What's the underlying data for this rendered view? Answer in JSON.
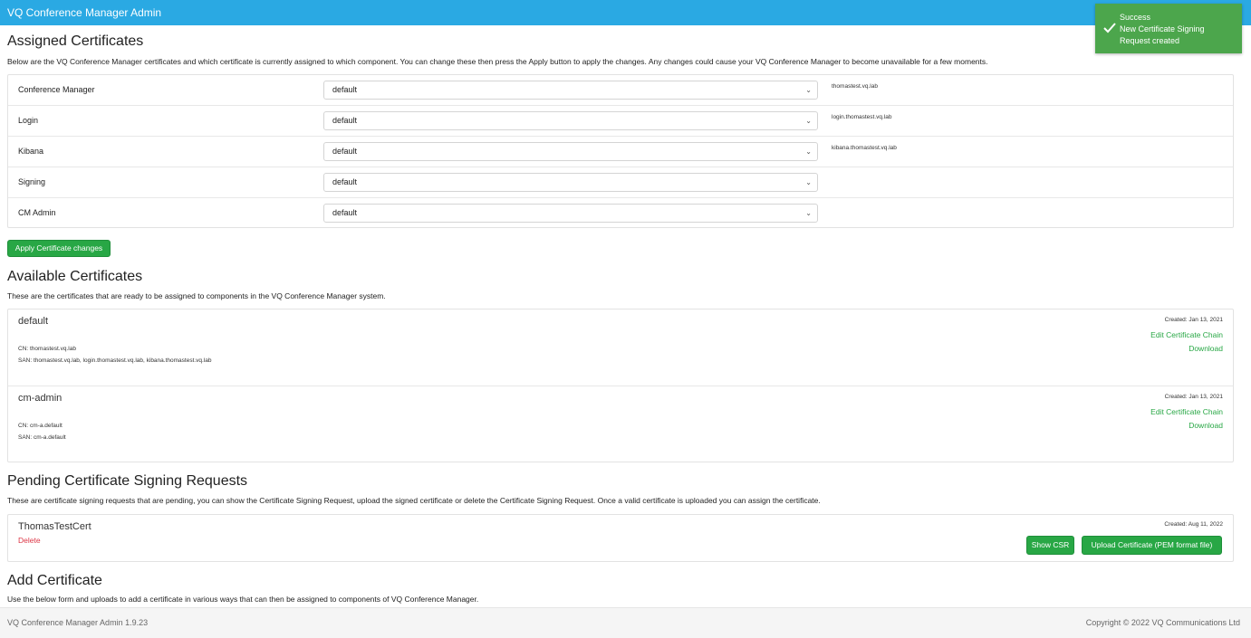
{
  "header": {
    "title": "VQ Conference Manager Admin"
  },
  "toast": {
    "title": "Success",
    "line1": "New Certificate Signing",
    "line2": "Request created",
    "icon": "check-icon"
  },
  "assigned": {
    "title": "Assigned Certificates",
    "description": "Below are the VQ Conference Manager certificates and which certificate is currently assigned to which component. You can change these then press the Apply button to apply the changes. Any changes could cause your VQ Conference Manager to become unavailable for a few moments.",
    "rows": [
      {
        "label": "Conference Manager",
        "value": "default",
        "host": "thomastest.vq.lab"
      },
      {
        "label": "Login",
        "value": "default",
        "host": "login.thomastest.vq.lab"
      },
      {
        "label": "Kibana",
        "value": "default",
        "host": "kibana.thomastest.vq.lab"
      },
      {
        "label": "Signing",
        "value": "default",
        "host": ""
      },
      {
        "label": "CM Admin",
        "value": "default",
        "host": ""
      }
    ],
    "apply_label": "Apply Certificate changes"
  },
  "available": {
    "title": "Available Certificates",
    "description": "These are the certificates that are ready to be assigned to components in the VQ Conference Manager system.",
    "certs": [
      {
        "name": "default",
        "cn": "CN: thomastest.vq.lab",
        "san": "SAN: thomastest.vq.lab, login.thomastest.vq.lab, kibana.thomastest.vq.lab",
        "created": "Created: Jan 13, 2021",
        "edit_label": "Edit Certificate Chain",
        "download_label": "Download"
      },
      {
        "name": "cm-admin",
        "cn": "CN: cm-a.default",
        "san": "SAN: cm-a.default",
        "created": "Created: Jan 13, 2021",
        "edit_label": "Edit Certificate Chain",
        "download_label": "Download"
      }
    ]
  },
  "pending": {
    "title": "Pending Certificate Signing Requests",
    "description": "These are certificate signing requests that are pending, you can show the Certificate Signing Request, upload the signed certificate or delete the Certificate Signing Request. Once a valid certificate is uploaded you can assign the certificate.",
    "item": {
      "name": "ThomasTestCert",
      "delete_label": "Delete",
      "created": "Created: Aug 11, 2022",
      "show_label": "Show CSR",
      "upload_label": "Upload Certificate (PEM format file)"
    }
  },
  "add": {
    "title": "Add Certificate",
    "description": "Use the below form and uploads to add a certificate in various ways that can then be assigned to components of VQ Conference Manager."
  },
  "footer": {
    "version": "VQ Conference Manager Admin 1.9.23",
    "copyright": "Copyright © 2022 VQ Communications Ltd"
  },
  "colors": {
    "header": "#2aa9e3",
    "success": "#28a745",
    "danger": "#dc3545",
    "toast": "#4ca64c"
  }
}
